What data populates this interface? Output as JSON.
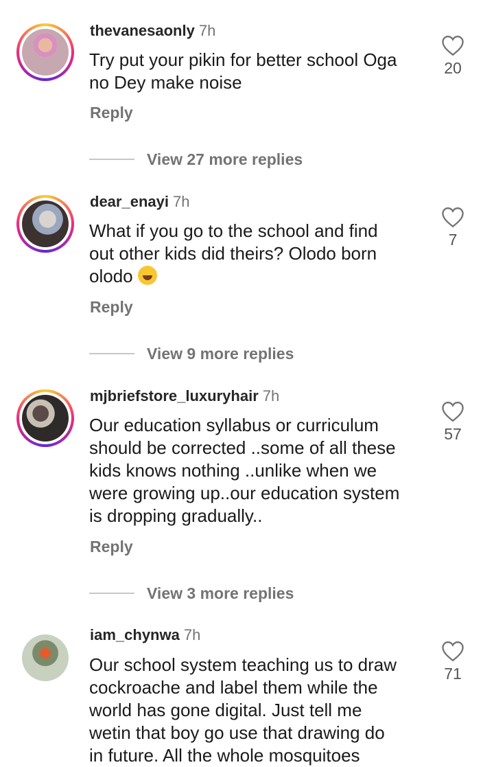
{
  "comments": [
    {
      "username": "thevanesaonly",
      "time": "7h",
      "text_lines": [
        "Try put your pikin for better school Oga",
        "no Dey make noise"
      ],
      "likes": "20",
      "reply_label": "Reply",
      "view_replies": "View 27 more replies"
    },
    {
      "username": "dear_enayi",
      "time": "7h",
      "text_lines": [
        "What if you go to the school and find",
        "out other kids did theirs? Olodo born",
        "olodo"
      ],
      "emoji": "rolling-on-floor-laughing",
      "likes": "7",
      "reply_label": "Reply",
      "view_replies": "View 9 more replies"
    },
    {
      "username": "mjbriefstore_luxuryhair",
      "time": "7h",
      "text_lines": [
        "Our education syllabus or curriculum",
        "should be corrected ..some of all these",
        "kids knows nothing ..unlike when we",
        "were growing up..our education system",
        "is dropping gradually.."
      ],
      "likes": "57",
      "reply_label": "Reply",
      "view_replies": "View 3 more replies"
    },
    {
      "username": "iam_chynwa",
      "time": "7h",
      "text_lines": [
        "Our school system teaching us to draw",
        "cockroache and label them while the",
        "world has gone digital. Just tell me",
        "wetin that boy go use that drawing do",
        "in future. All the whole mosquitoes"
      ],
      "likes": "71"
    }
  ],
  "icons": {
    "like": "heart-outline-icon"
  },
  "colors": {
    "story_ring": "#ee2a7b",
    "secondary_text": "#737373"
  }
}
